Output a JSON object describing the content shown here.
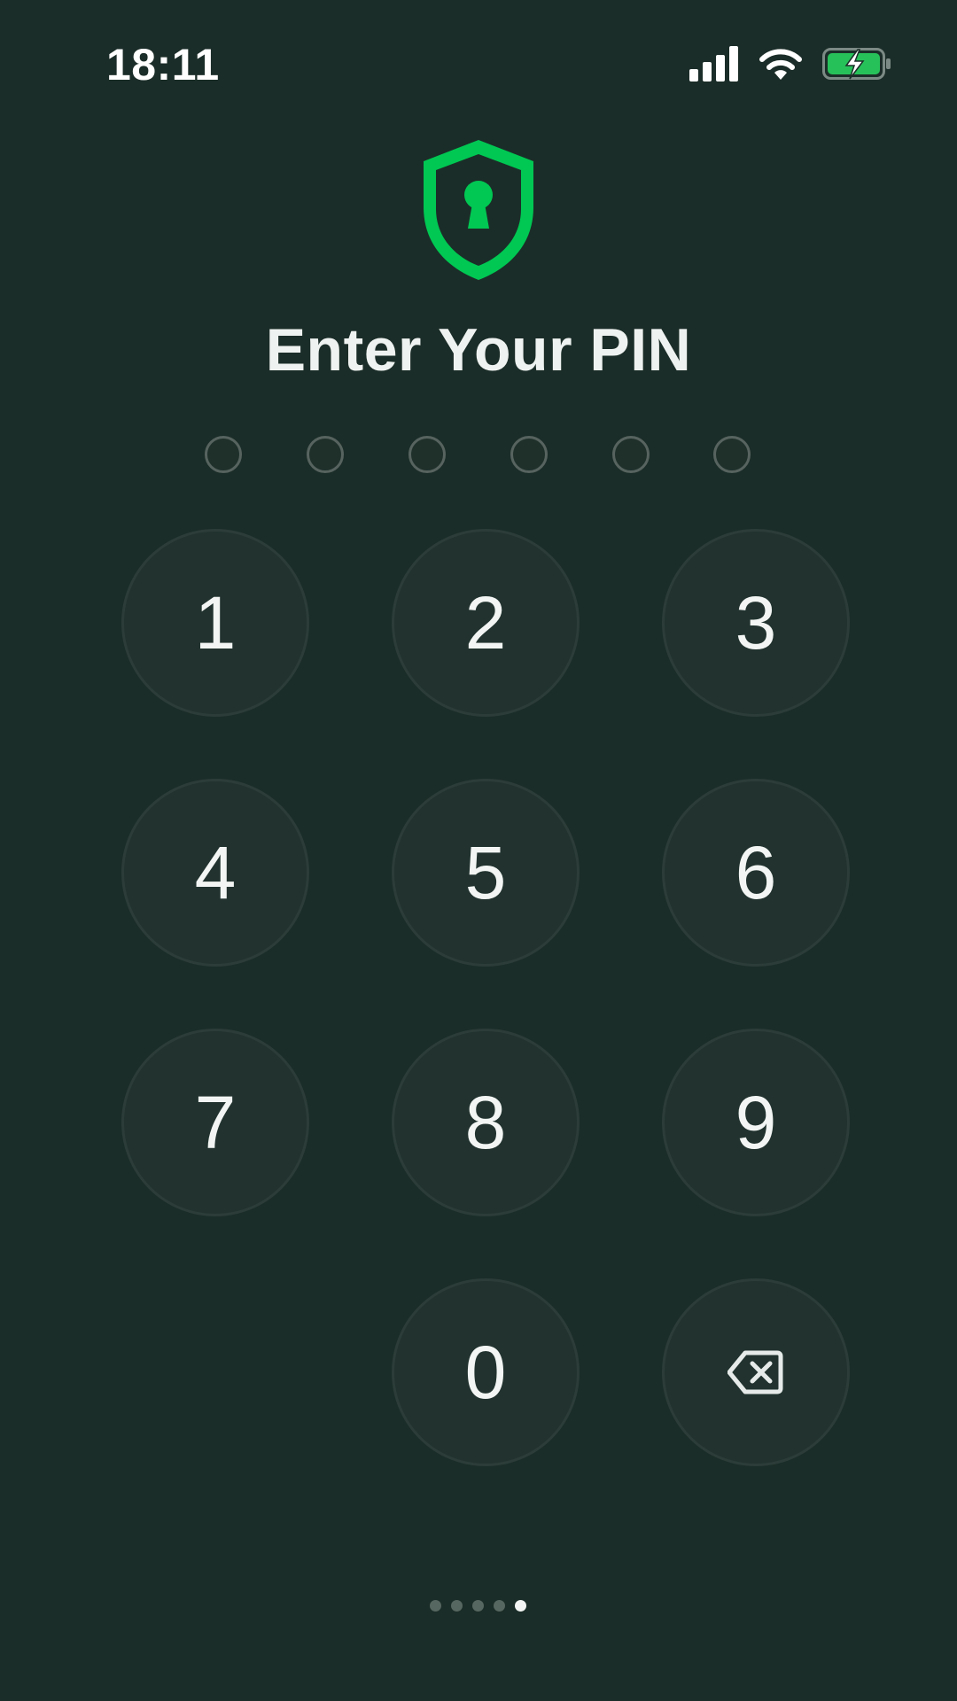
{
  "status_bar": {
    "time": "18:11",
    "icons": [
      "signal-icon",
      "wifi-icon",
      "battery-charging-icon"
    ]
  },
  "header": {
    "icon": "shield-lock-icon",
    "title": "Enter Your PIN"
  },
  "pin": {
    "length": 6,
    "filled": 0
  },
  "keypad": {
    "keys": [
      "1",
      "2",
      "3",
      "4",
      "5",
      "6",
      "7",
      "8",
      "9",
      "0"
    ],
    "backspace_icon": "backspace-icon"
  },
  "page_indicator": {
    "count": 5,
    "active_index": 4
  },
  "colors": {
    "background": "#1b2d28",
    "accent": "#00c853",
    "key_fill": "#22332f",
    "text": "#eef2f0"
  }
}
